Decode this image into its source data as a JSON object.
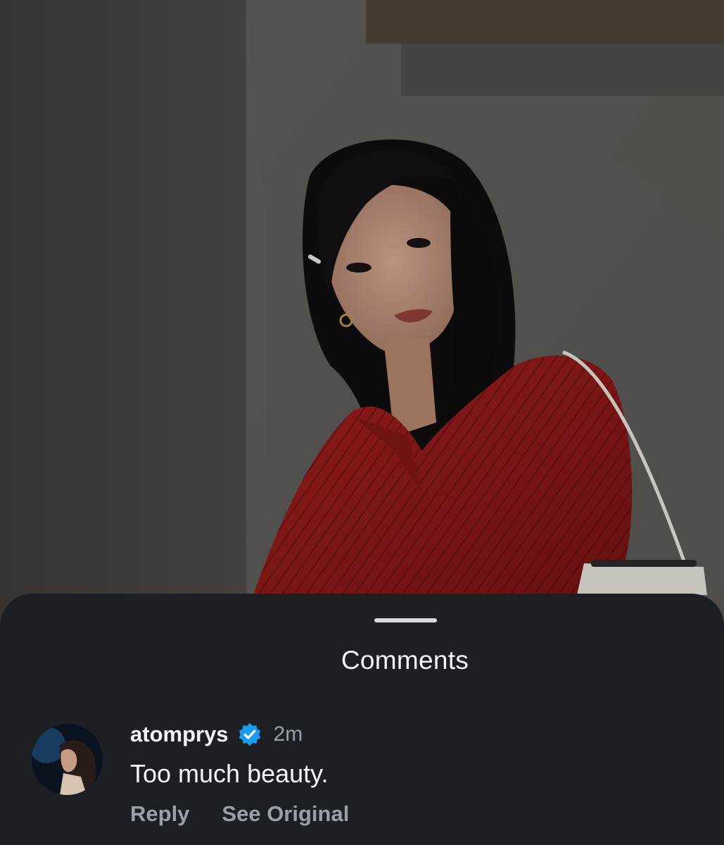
{
  "sheet": {
    "title": "Comments"
  },
  "comment": {
    "username": "atomprys",
    "time": "2m",
    "text": "Too much beauty.",
    "actions": {
      "reply": "Reply",
      "see_original": "See Original"
    }
  },
  "colors": {
    "sheet_bg": "#1c1f24",
    "verified_badge": "#1d9bf0",
    "secondary_text": "#9aa0a8",
    "photo_shirt": "#8a1a1a"
  },
  "icons": {
    "verified": "verified-badge-icon"
  }
}
